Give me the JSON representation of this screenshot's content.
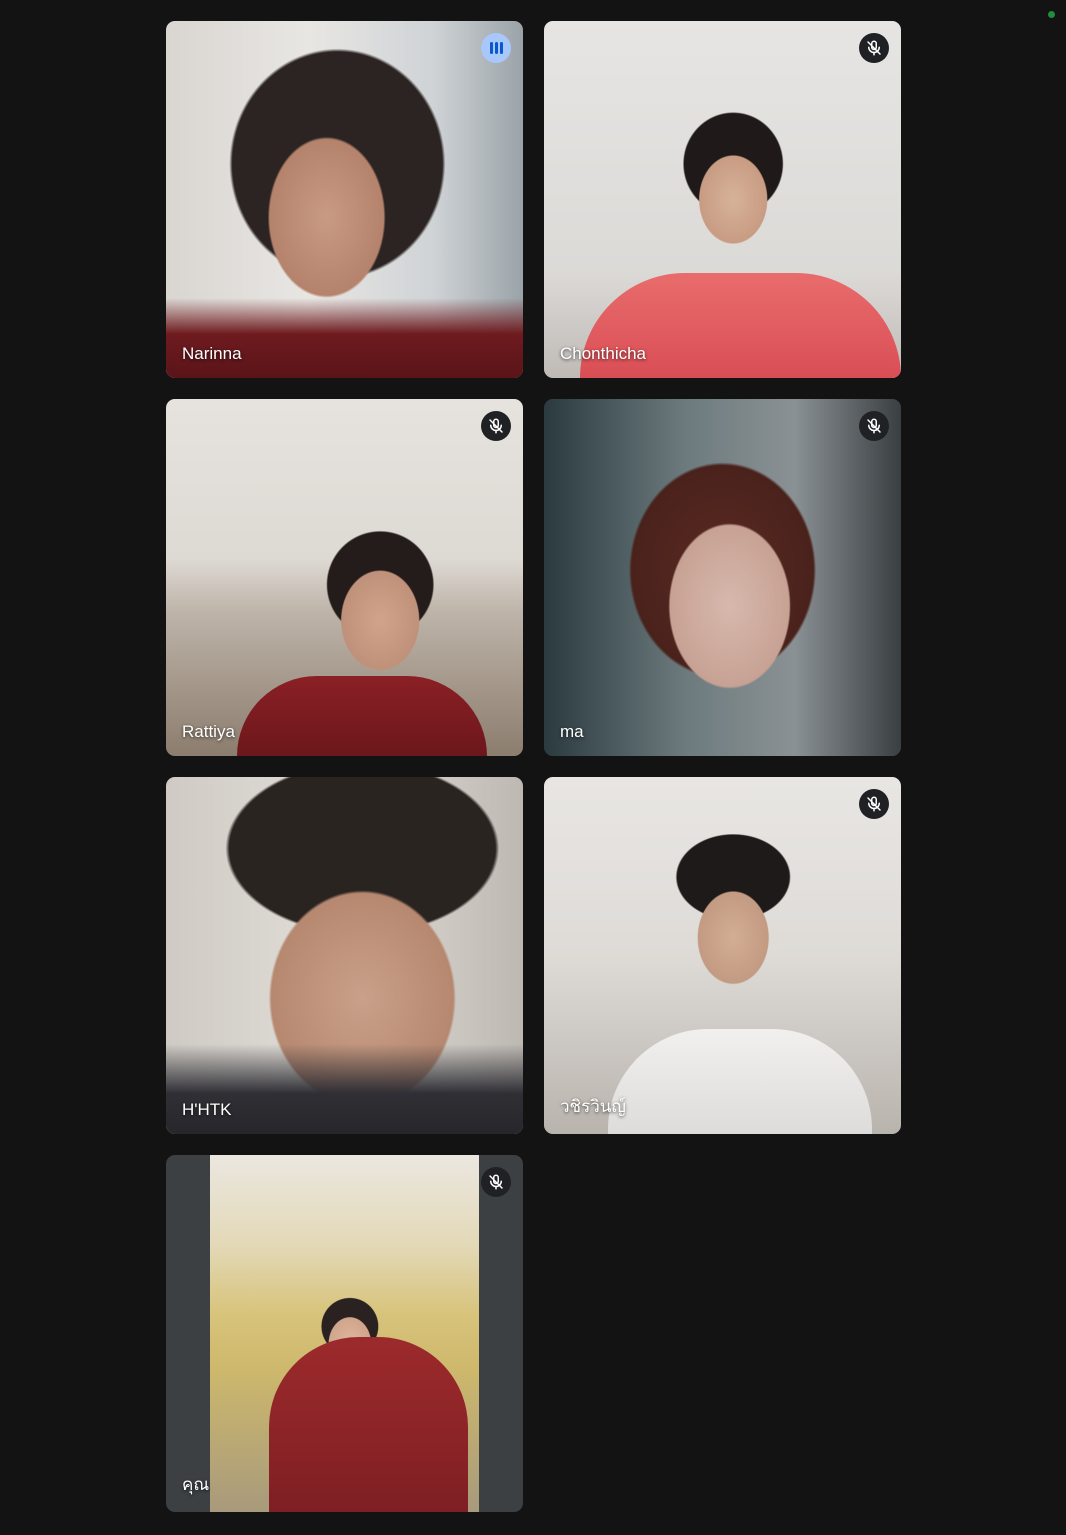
{
  "status_indicator_color": "#1e8e3e",
  "participants": [
    {
      "name": "Narinna",
      "state": "speaking",
      "icon": "audio-level-icon"
    },
    {
      "name": "Chonthicha",
      "state": "muted",
      "icon": "mic-off-icon"
    },
    {
      "name": "Rattiya",
      "state": "muted",
      "icon": "mic-off-icon"
    },
    {
      "name": "ma",
      "state": "muted",
      "icon": "mic-off-icon"
    },
    {
      "name": "H'HTK",
      "state": "unmuted",
      "icon": ""
    },
    {
      "name": "วชิรวินญ์",
      "state": "muted",
      "icon": "mic-off-icon"
    },
    {
      "name": "คุณ",
      "state": "muted",
      "icon": "mic-off-icon"
    }
  ]
}
